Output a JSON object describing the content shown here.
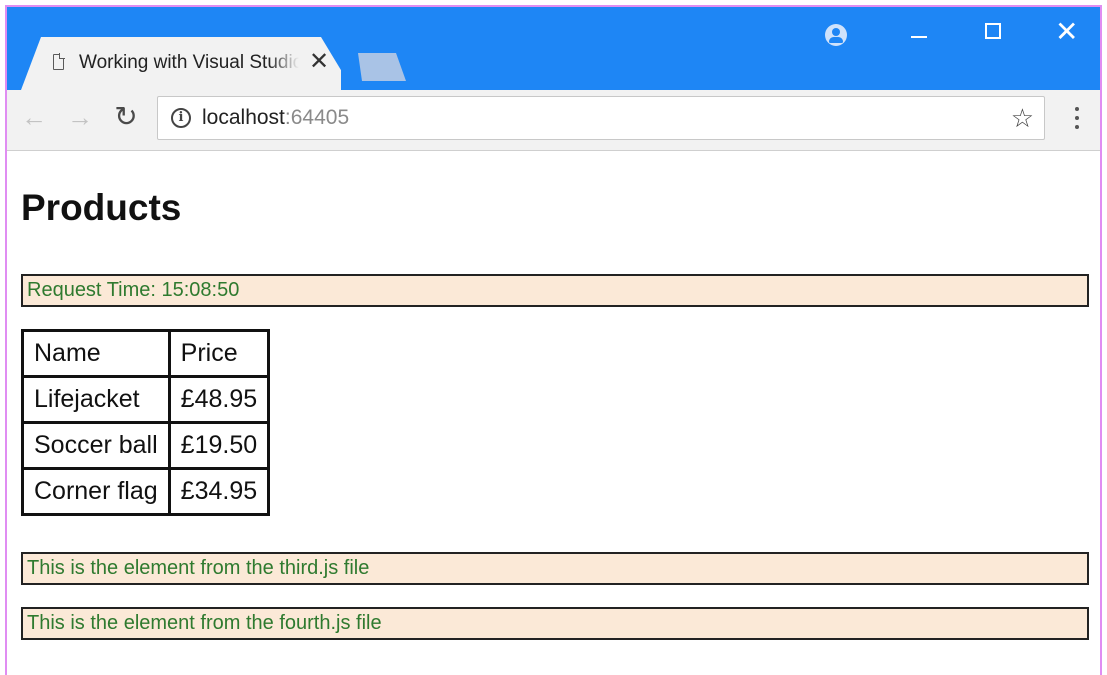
{
  "browser": {
    "tab_title": "Working with Visual Studio",
    "tab_close": "✕",
    "url_host": "localhost",
    "url_port": ":64405",
    "info_glyph": "i",
    "back_glyph": "←",
    "forward_glyph": "→",
    "reload_glyph": "↻",
    "star_glyph": "☆",
    "close_glyph": "✕",
    "accent_color": "#1e86f5"
  },
  "page": {
    "heading": "Products",
    "request_time": "Request Time: 15:08:50",
    "table": {
      "headers": [
        "Name",
        "Price"
      ],
      "rows": [
        [
          "Lifejacket",
          "£48.95"
        ],
        [
          "Soccer ball",
          "£19.50"
        ],
        [
          "Corner flag",
          "£34.95"
        ]
      ]
    },
    "third_message": "This is the element from the third.js file",
    "fourth_message": "This is the element from the fourth.js file"
  }
}
